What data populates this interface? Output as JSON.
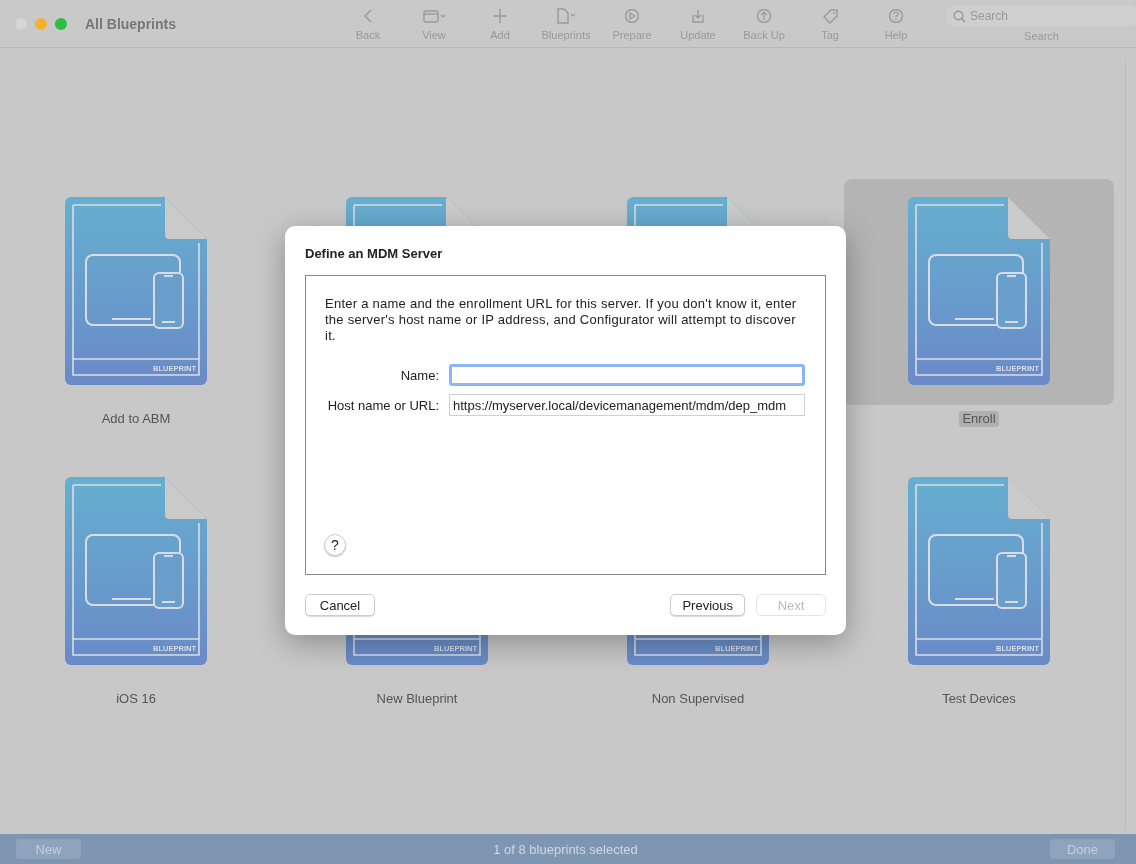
{
  "window": {
    "title": "All Blueprints"
  },
  "toolbar": {
    "items": [
      {
        "label": "Back"
      },
      {
        "label": "View"
      },
      {
        "label": "Add"
      },
      {
        "label": "Blueprints"
      },
      {
        "label": "Prepare"
      },
      {
        "label": "Update"
      },
      {
        "label": "Back Up"
      },
      {
        "label": "Tag"
      },
      {
        "label": "Help"
      }
    ],
    "search": {
      "placeholder": "Search",
      "label": "Search"
    }
  },
  "blueprints": [
    {
      "name": "Add to ABM",
      "badge": "BLUEPRINT",
      "selected": false
    },
    {
      "selected": false
    },
    {
      "selected": false
    },
    {
      "name": "Enroll",
      "badge": "BLUEPRINT",
      "selected": true
    },
    {
      "name": "iOS 16",
      "badge": "BLUEPRINT",
      "selected": false
    },
    {
      "name": "New Blueprint",
      "badge": "BLUEPRINT",
      "selected": false
    },
    {
      "name": "Non Supervised",
      "badge": "BLUEPRINT",
      "selected": false
    },
    {
      "name": "Test Devices",
      "badge": "BLUEPRINT",
      "selected": false
    }
  ],
  "dialog": {
    "title": "Define an MDM Server",
    "description": "Enter a name and the enrollment URL for this server. If you don't know it, enter the server's host name or IP address, and Configurator will attempt to discover it.",
    "fields": [
      {
        "label": "Name:",
        "focused": true
      },
      {
        "label": "Host name or URL:",
        "value": "https://myserver.local/devicemanagement/mdm/dep_mdm",
        "focused": false
      }
    ],
    "help": "?",
    "buttons": [
      {
        "label": "Cancel",
        "disabled": false,
        "kind": "left"
      },
      {
        "label": "Previous",
        "disabled": false,
        "kind": "right"
      },
      {
        "label": "Next",
        "disabled": true,
        "kind": "right"
      }
    ]
  },
  "bottom_bar": {
    "left_button": "New",
    "status": "1 of 8 blueprints selected",
    "right_button": "Done"
  }
}
